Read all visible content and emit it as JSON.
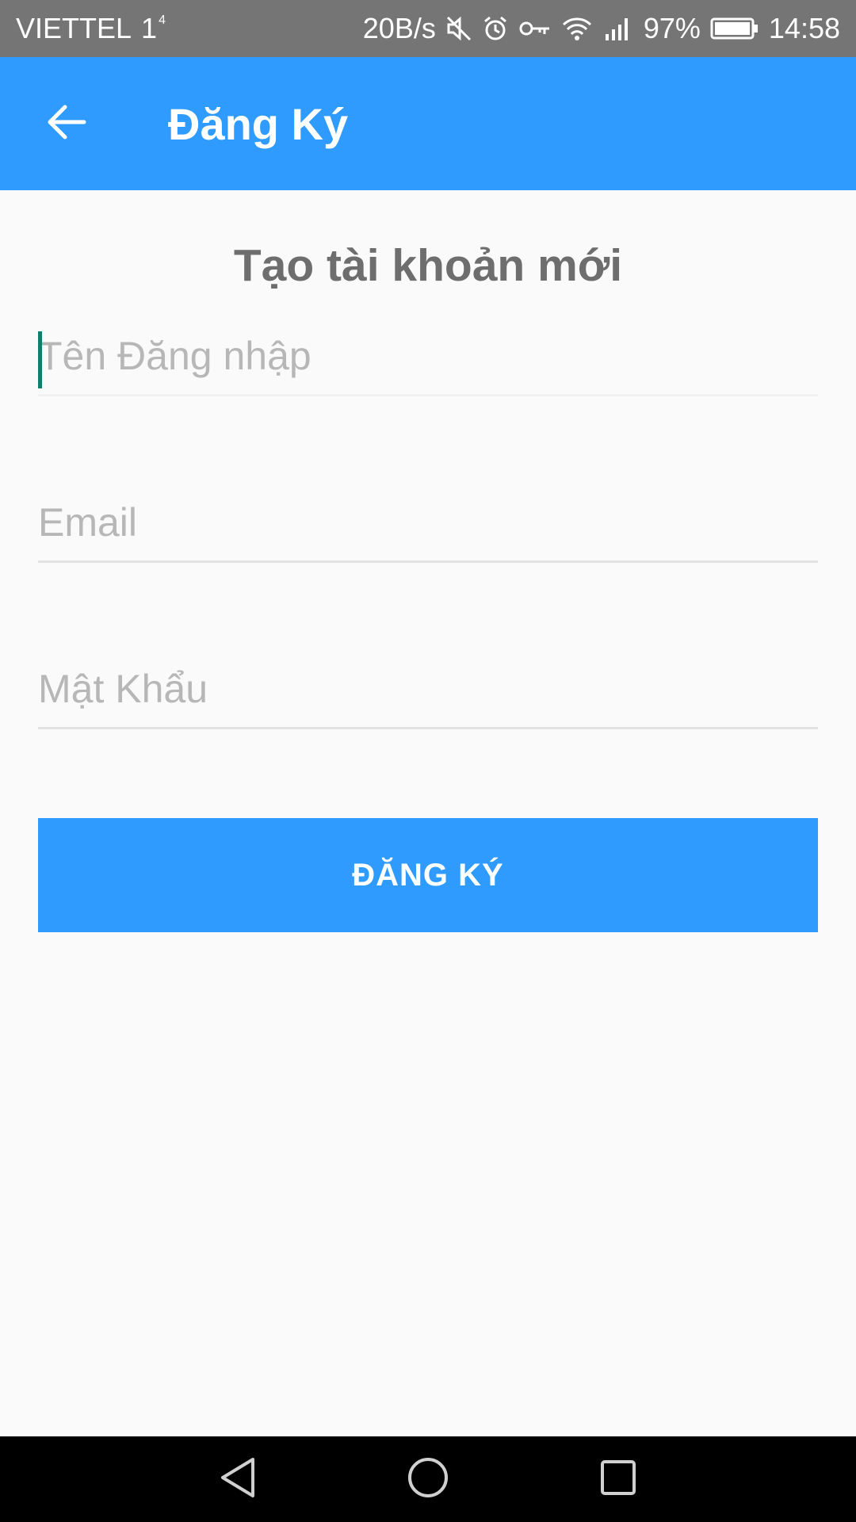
{
  "status_bar": {
    "carrier": "VIETTEL",
    "carrier_signal": "1",
    "carrier_sup": "4",
    "net_speed": "20B/s",
    "battery": "97%",
    "time": "14:58",
    "icons": [
      "mute-icon",
      "alarm-icon",
      "vpn-key-icon",
      "wifi-icon",
      "signal-icon",
      "battery-icon"
    ]
  },
  "app_bar": {
    "title": "Đăng Ký",
    "back_icon": "arrow-left-icon"
  },
  "form": {
    "heading": "Tạo tài khoản mới",
    "username": {
      "placeholder": "Tên Đăng nhập",
      "value": ""
    },
    "email": {
      "placeholder": "Email",
      "value": ""
    },
    "password": {
      "placeholder": "Mật Khẩu",
      "value": ""
    },
    "submit_label": "ĐĂNG KÝ"
  },
  "colors": {
    "primary": "#2f9bff",
    "status_bar": "#757575",
    "background": "#fafafa",
    "heading_text": "#6e6e6e",
    "placeholder": "#b7b7b7",
    "caret": "#0d7f6a"
  },
  "nav_bar": {
    "icons": [
      "nav-back-icon",
      "nav-home-icon",
      "nav-recents-icon"
    ]
  }
}
